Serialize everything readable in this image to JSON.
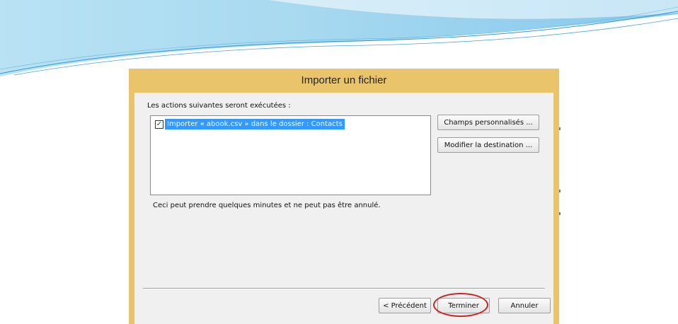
{
  "dialog": {
    "title": "Importer un fichier",
    "actions_label": "Les actions suivantes seront exécutées :",
    "actions": [
      {
        "label": "Importer « abook.csv » dans le dossier : Contacts",
        "checked": true
      }
    ],
    "side_buttons": {
      "custom_fields": "Champs personnalisés ...",
      "change_destination": "Modifier la destination ..."
    },
    "note": "Ceci peut prendre quelques minutes et ne peut pas être annulé.",
    "footer_buttons": {
      "back": "< Précédent",
      "finish": "Terminer",
      "cancel": "Annuler"
    }
  },
  "colors": {
    "title_bar": "#e9c46a",
    "selection": "#3399ff",
    "highlight_ring": "#cc2222"
  },
  "icons": {
    "checkbox": "check-icon"
  }
}
